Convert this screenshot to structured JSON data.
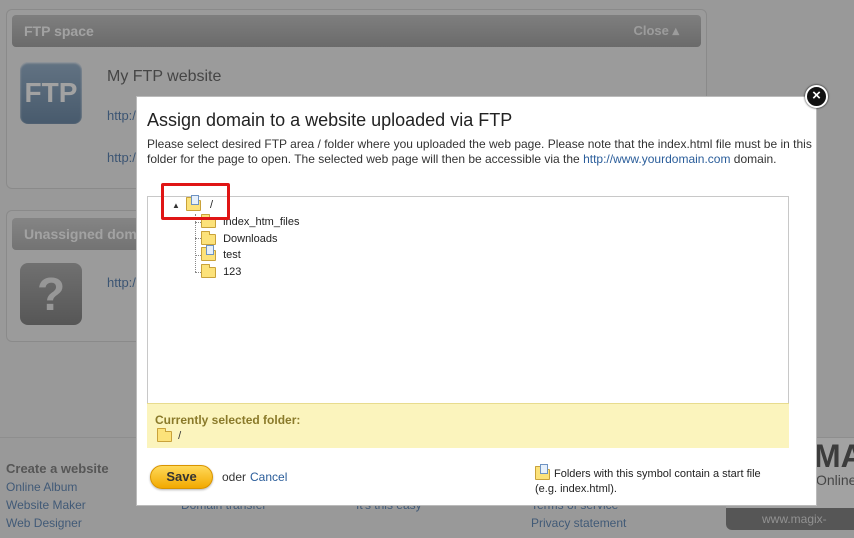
{
  "ftp_panel": {
    "header": "FTP space",
    "close_label": "Close ▴",
    "logo_text": "FTP",
    "site_title": "My FTP website",
    "links": [
      "http://",
      "http://"
    ]
  },
  "unassigned_panel": {
    "header": "Unassigned domains",
    "logo_text": "?",
    "link": "http://"
  },
  "footer": {
    "title": "Create a website",
    "col1": [
      "Online Album",
      "Website Maker",
      "Web Designer"
    ],
    "col2": [
      "Domain transfer"
    ],
    "col3": [
      "It's this easy"
    ],
    "col4": [
      "Terms of service",
      "Privacy statement"
    ]
  },
  "magix": {
    "logo": "MAGIX",
    "sub": "Online",
    "url": "www.magix-online.com"
  },
  "dialog": {
    "title": "Assign domain to a website uploaded via FTP",
    "desc_before": "Please select desired FTP area / folder where you uploaded the web page. Please note that the index.html file must be in this folder for the page to open. The selected web page will then be accessible via the ",
    "desc_link": "http://www.yourdomain.com",
    "desc_after": " domain.",
    "close_symbol": "×",
    "tree": {
      "root": "/",
      "children": [
        "index_htm_files",
        "Downloads",
        "test",
        "123"
      ]
    },
    "selected_label": "Currently selected folder:",
    "selected_path": "/",
    "save_label": "Save",
    "oder_label": "oder",
    "cancel_label": "Cancel",
    "note": "Folders with this symbol contain a start file (e.g. index.html)."
  },
  "colors": {
    "accent": "#f2a900",
    "link": "#2a5d9a",
    "highlight": "#e01515",
    "selected_bg": "#fbf4bd"
  }
}
